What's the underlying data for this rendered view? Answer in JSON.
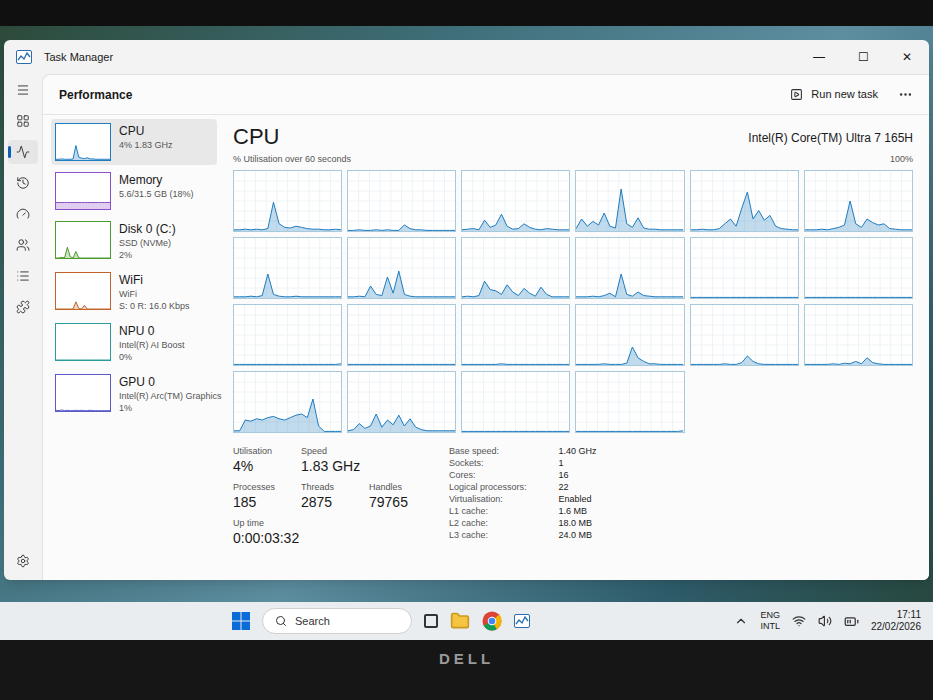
{
  "window": {
    "title": "Task Manager",
    "controls": [
      "—",
      "☐",
      "✕"
    ]
  },
  "header": {
    "title": "Performance",
    "run_new_task": "Run new task"
  },
  "nav": [
    {
      "selected": false
    },
    {
      "selected": false
    },
    {
      "selected": true
    },
    {
      "selected": false
    },
    {
      "selected": false
    },
    {
      "selected": false
    },
    {
      "selected": false
    },
    {
      "selected": false
    }
  ],
  "resources": [
    {
      "name": "CPU",
      "lines": [
        "4% 1.83 GHz"
      ],
      "selected": true,
      "color": "#1f7cc0",
      "series": [
        2,
        2,
        3,
        2,
        2,
        2,
        3,
        40,
        8,
        5,
        4,
        6,
        3,
        3,
        2,
        2,
        2,
        2,
        2,
        2
      ]
    },
    {
      "name": "Memory",
      "lines": [
        "5.6/31.5 GB (18%)"
      ],
      "selected": false,
      "color": "#8b4fc7",
      "series": [
        18,
        18,
        18,
        18,
        18,
        18,
        18,
        18,
        18,
        18,
        18,
        18,
        18,
        18,
        18,
        18,
        18,
        18,
        18,
        18
      ]
    },
    {
      "name": "Disk 0 (C:)",
      "lines": [
        "SSD (NVMe)",
        "2%"
      ],
      "selected": false,
      "color": "#4d9a2e",
      "series": [
        0,
        0,
        2,
        0,
        30,
        4,
        0,
        18,
        0,
        0,
        0,
        0,
        0,
        0,
        0,
        0,
        0,
        0,
        0,
        0
      ]
    },
    {
      "name": "WiFi",
      "lines": [
        "WiFi",
        "S: 0 R: 16.0 Kbps"
      ],
      "selected": false,
      "color": "#c0642a",
      "series": [
        0,
        0,
        0,
        0,
        0,
        0,
        0,
        20,
        2,
        0,
        10,
        0,
        0,
        0,
        0,
        0,
        0,
        0,
        0,
        0
      ]
    },
    {
      "name": "NPU 0",
      "lines": [
        "Intel(R) AI Boost",
        "0%"
      ],
      "selected": false,
      "color": "#2a9a9a",
      "series": [
        0,
        0,
        0,
        0,
        0,
        0,
        0,
        0,
        0,
        0,
        0,
        0,
        0,
        0,
        0,
        0,
        0,
        0,
        0,
        0
      ]
    },
    {
      "name": "GPU 0",
      "lines": [
        "Intel(R) Arc(TM) Graphics",
        "1%"
      ],
      "selected": false,
      "color": "#5a5ac8",
      "series": [
        2,
        1,
        3,
        1,
        2,
        1,
        1,
        2,
        1,
        2,
        1,
        1,
        2,
        1,
        1,
        1,
        1,
        1,
        1,
        1
      ]
    }
  ],
  "cpu": {
    "title": "CPU",
    "model": "Intel(R) Core(TM) Ultra 7 165H",
    "axis_label": "% Utilisation over 60 seconds",
    "axis_max": "100%",
    "cores": [
      [
        2,
        2,
        3,
        2,
        3,
        2,
        4,
        48,
        12,
        6,
        5,
        8,
        6,
        4,
        3,
        3,
        2,
        2,
        3,
        2
      ],
      [
        1,
        1,
        2,
        1,
        1,
        2,
        1,
        2,
        1,
        1,
        10,
        4,
        2,
        2,
        1,
        1,
        1,
        1,
        1,
        1
      ],
      [
        2,
        3,
        4,
        2,
        18,
        6,
        10,
        28,
        8,
        3,
        4,
        12,
        6,
        3,
        2,
        4,
        3,
        2,
        2,
        2
      ],
      [
        4,
        20,
        8,
        16,
        10,
        30,
        8,
        5,
        70,
        12,
        6,
        22,
        5,
        3,
        3,
        2,
        2,
        2,
        2,
        2
      ],
      [
        2,
        2,
        3,
        2,
        2,
        4,
        12,
        20,
        8,
        38,
        65,
        20,
        34,
        18,
        26,
        8,
        4,
        3,
        2,
        2
      ],
      [
        2,
        2,
        2,
        3,
        2,
        4,
        6,
        10,
        50,
        12,
        6,
        20,
        14,
        10,
        12,
        4,
        3,
        2,
        2,
        2
      ],
      [
        2,
        2,
        2,
        3,
        2,
        4,
        40,
        6,
        3,
        2,
        2,
        3,
        2,
        2,
        2,
        2,
        2,
        2,
        2,
        2
      ],
      [
        2,
        2,
        3,
        2,
        20,
        6,
        4,
        35,
        8,
        45,
        6,
        3,
        2,
        2,
        2,
        2,
        2,
        2,
        2,
        2
      ],
      [
        2,
        3,
        2,
        4,
        28,
        14,
        12,
        6,
        22,
        10,
        4,
        16,
        8,
        3,
        18,
        6,
        2,
        2,
        2,
        2
      ],
      [
        2,
        2,
        2,
        3,
        2,
        4,
        8,
        2,
        40,
        6,
        3,
        10,
        4,
        3,
        2,
        2,
        2,
        2,
        2,
        2
      ],
      [
        1,
        1,
        1,
        1,
        1,
        1,
        1,
        1,
        1,
        1,
        1,
        1,
        1,
        1,
        1,
        1,
        1,
        1,
        1,
        1
      ],
      [
        1,
        1,
        1,
        1,
        1,
        1,
        1,
        1,
        1,
        1,
        1,
        1,
        1,
        1,
        1,
        1,
        1,
        1,
        1,
        1
      ],
      [
        1,
        1,
        1,
        1,
        1,
        1,
        1,
        1,
        1,
        1,
        1,
        1,
        1,
        1,
        1,
        1,
        1,
        1,
        1,
        2
      ],
      [
        1,
        1,
        1,
        1,
        1,
        1,
        1,
        1,
        1,
        1,
        1,
        1,
        1,
        1,
        1,
        1,
        1,
        1,
        1,
        1
      ],
      [
        1,
        1,
        1,
        1,
        1,
        1,
        1,
        2,
        1,
        1,
        1,
        1,
        1,
        1,
        1,
        1,
        1,
        1,
        1,
        1
      ],
      [
        1,
        1,
        1,
        1,
        1,
        2,
        1,
        1,
        1,
        3,
        30,
        12,
        6,
        2,
        2,
        1,
        1,
        1,
        1,
        1
      ],
      [
        1,
        1,
        1,
        1,
        1,
        1,
        2,
        1,
        1,
        4,
        15,
        6,
        2,
        1,
        1,
        1,
        1,
        1,
        1,
        1
      ],
      [
        1,
        1,
        1,
        1,
        1,
        2,
        1,
        3,
        2,
        6,
        2,
        12,
        4,
        2,
        1,
        1,
        1,
        1,
        1,
        1
      ],
      [
        2,
        2,
        20,
        18,
        22,
        20,
        24,
        26,
        22,
        20,
        24,
        28,
        30,
        24,
        55,
        10,
        1,
        1,
        1,
        1
      ],
      [
        2,
        4,
        14,
        6,
        10,
        30,
        8,
        20,
        12,
        28,
        10,
        22,
        8,
        4,
        2,
        2,
        2,
        2,
        2,
        2
      ],
      [
        1,
        1,
        1,
        1,
        1,
        1,
        1,
        1,
        1,
        1,
        1,
        1,
        1,
        1,
        1,
        1,
        1,
        1,
        1,
        1
      ],
      [
        1,
        1,
        1,
        1,
        1,
        1,
        1,
        1,
        1,
        1,
        1,
        1,
        1,
        1,
        1,
        1,
        1,
        1,
        1,
        2
      ]
    ]
  },
  "stats": [
    [
      {
        "label": "Utilisation",
        "value": "4%"
      },
      {
        "label": "Speed",
        "value": "1.83 GHz"
      }
    ],
    [
      {
        "label": "Processes",
        "value": "185"
      },
      {
        "label": "Threads",
        "value": "2875"
      },
      {
        "label": "Handles",
        "value": "79765"
      }
    ],
    [
      {
        "label": "Up time",
        "value": "0:00:03:32"
      }
    ]
  ],
  "specs": [
    {
      "label": "Base speed:",
      "value": "1.40 GHz"
    },
    {
      "label": "Sockets:",
      "value": "1"
    },
    {
      "label": "Cores:",
      "value": "16"
    },
    {
      "label": "Logical processors:",
      "value": "22"
    },
    {
      "label": "Virtualisation:",
      "value": "Enabled"
    },
    {
      "label": "L1 cache:",
      "value": "1.6 MB"
    },
    {
      "label": "L2 cache:",
      "value": "18.0 MB"
    },
    {
      "label": "L3 cache:",
      "value": "24.0 MB"
    }
  ],
  "taskbar": {
    "search": "Search",
    "language": [
      "ENG",
      "INTL"
    ],
    "time": "17:11",
    "date": "22/02/2026"
  },
  "bezel": {
    "logo": "DELL"
  }
}
